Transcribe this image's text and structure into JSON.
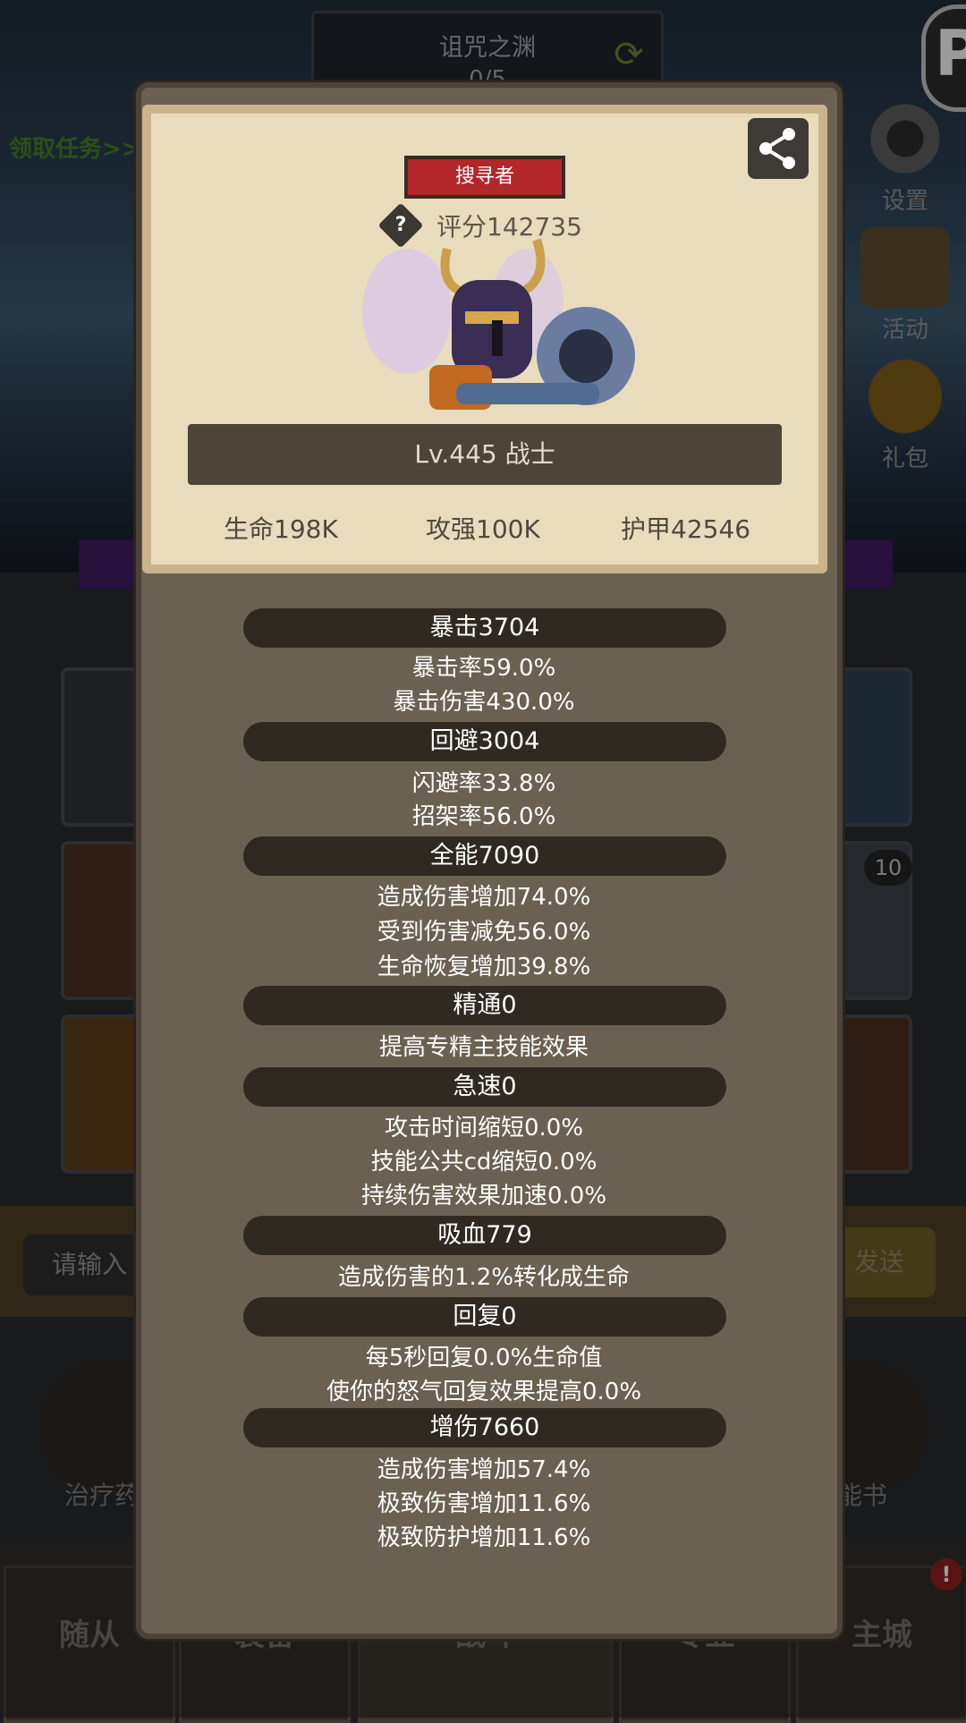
{
  "background": {
    "dungeon_name": "诅咒之渊",
    "dungeon_progress": "0/5",
    "quest_link": "领取任务>>",
    "side_buttons": [
      "设置",
      "活动",
      "礼包"
    ],
    "badge_count": "10",
    "input_placeholder": "请输入",
    "send_label": "发送",
    "left_round_label": "治疗药",
    "right_round_label": "能书",
    "bottom_tabs": [
      "随从",
      "装备",
      "战斗",
      "专业",
      "主城"
    ],
    "alert_badge": "!"
  },
  "profile": {
    "rank": "搜寻者",
    "score": "评分142735",
    "level_class": "Lv.445 战士",
    "core_stats": [
      "生命198K",
      "攻强100K",
      "护甲42546"
    ]
  },
  "stats": [
    {
      "header": "暴击3704",
      "lines": [
        "暴击率59.0%",
        "暴击伤害430.0%"
      ]
    },
    {
      "header": "回避3004",
      "lines": [
        "闪避率33.8%",
        "招架率56.0%"
      ]
    },
    {
      "header": "全能7090",
      "lines": [
        "造成伤害增加74.0%",
        "受到伤害减免56.0%",
        "生命恢复增加39.8%"
      ]
    },
    {
      "header": "精通0",
      "lines": [
        "提高专精主技能效果"
      ]
    },
    {
      "header": "急速0",
      "lines": [
        "攻击时间缩短0.0%",
        "技能公共cd缩短0.0%",
        "持续伤害效果加速0.0%"
      ]
    },
    {
      "header": "吸血779",
      "lines": [
        "造成伤害的1.2%转化成生命"
      ]
    },
    {
      "header": "回复0",
      "lines": [
        "每5秒回复0.0%生命值",
        "使你的怒气回复效果提高0.0%"
      ]
    },
    {
      "header": "增伤7660",
      "lines": [
        "造成伤害增加57.4%",
        "极致伤害增加11.6%",
        "极致防护增加11.6%"
      ]
    }
  ]
}
